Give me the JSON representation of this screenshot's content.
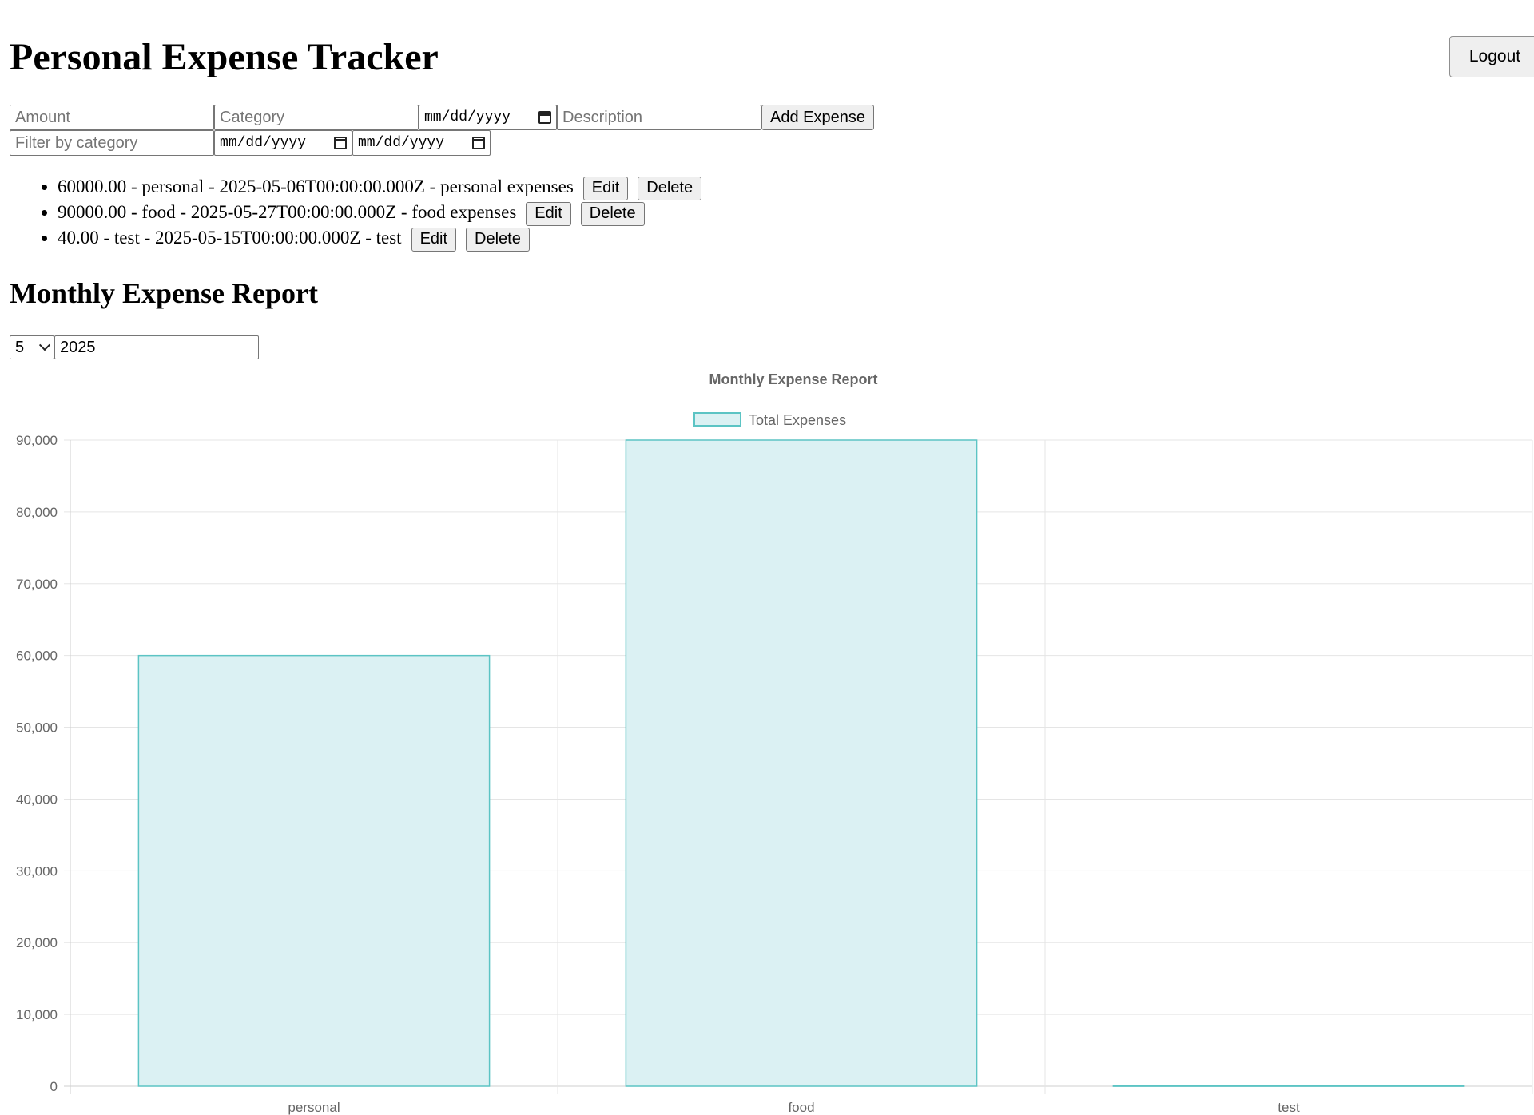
{
  "header": {
    "title": "Personal Expense Tracker",
    "logout_label": "Logout"
  },
  "add_form": {
    "amount_placeholder": "Amount",
    "category_placeholder": "Category",
    "date_value": "mm/dd/yyyy",
    "description_placeholder": "Description",
    "add_label": "Add Expense"
  },
  "filter_form": {
    "category_placeholder": "Filter by category",
    "start_date_value": "mm/dd/yyyy",
    "end_date_value": "mm/dd/yyyy"
  },
  "expenses": [
    {
      "text": "60000.00 - personal - 2025-05-06T00:00:00.000Z - personal expenses",
      "edit_label": "Edit",
      "delete_label": "Delete"
    },
    {
      "text": "90000.00 - food - 2025-05-27T00:00:00.000Z - food expenses",
      "edit_label": "Edit",
      "delete_label": "Delete"
    },
    {
      "text": "40.00 - test - 2025-05-15T00:00:00.000Z - test",
      "edit_label": "Edit",
      "delete_label": "Delete"
    }
  ],
  "report": {
    "heading": "Monthly Expense Report",
    "month_value": "5",
    "year_value": "2025"
  },
  "chart_data": {
    "type": "bar",
    "title": "Monthly Expense Report",
    "categories": [
      "personal",
      "food",
      "test"
    ],
    "series": [
      {
        "name": "Total Expenses",
        "values": [
          60000,
          90000,
          40
        ]
      }
    ],
    "ylim": [
      0,
      90000
    ],
    "y_ticks": [
      "0",
      "10,000",
      "20,000",
      "30,000",
      "40,000",
      "50,000",
      "60,000",
      "70,000",
      "80,000",
      "90,000"
    ],
    "grid": true,
    "legend": "top",
    "bar_fill": "#dbf1f3",
    "bar_stroke": "#5cc4c4",
    "grid_color": "#e5e5e5",
    "text_color": "#666666"
  }
}
